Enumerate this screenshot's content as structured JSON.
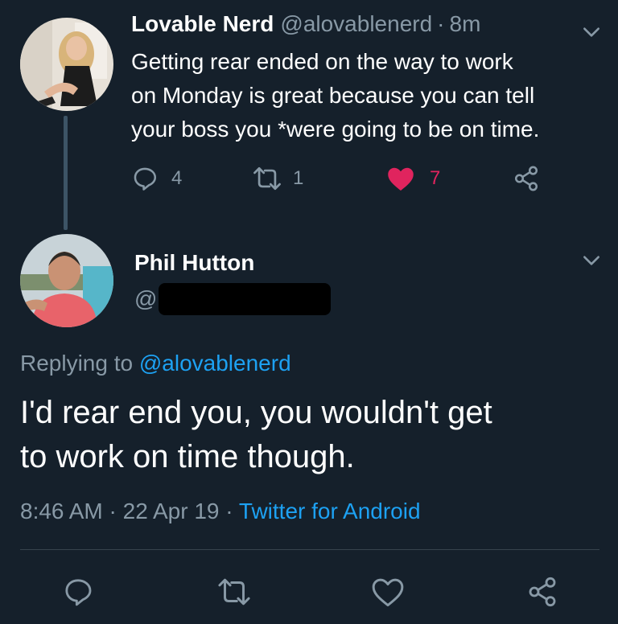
{
  "original_tweet": {
    "display_name": "Lovable Nerd",
    "handle": "@alovablenerd",
    "separator": "·",
    "age": "8m",
    "text_lines": [
      "Getting rear ended on the way to work",
      "on Monday is great because you can tell",
      "your boss you *were going to be on time."
    ],
    "reply_count": "4",
    "retweet_count": "1",
    "like_count": "7",
    "liked": true,
    "like_color": "#e0245e"
  },
  "reply_tweet": {
    "display_name": "Phil Hutton",
    "handle_prefix": "@",
    "handle_redacted": true,
    "replying_label": "Replying to",
    "replying_to": "@alovablenerd",
    "text_lines": [
      "I'd rear end you, you wouldn't get",
      "to work on time though."
    ],
    "time": "8:46 AM",
    "dot1": "·",
    "date": "22 Apr 19",
    "dot2": "·",
    "source": "Twitter for Android"
  },
  "actions_bar": {
    "icons": [
      "reply-icon",
      "retweet-icon",
      "like-icon",
      "share-icon"
    ]
  },
  "colors": {
    "background": "#15202b",
    "muted": "#8899a6",
    "accent": "#1da1f2",
    "like": "#e0245e"
  }
}
